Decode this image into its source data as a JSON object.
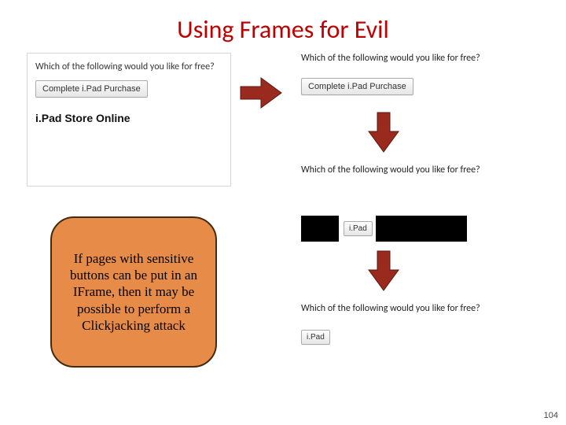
{
  "title": "Using Frames for Evil",
  "left_panel": {
    "question": "Which of the following would you like for free?",
    "button_label": "Complete i.Pad Purchase",
    "store_line": "i.Pad Store Online"
  },
  "right": {
    "q1": "Which of the following would you like for free?",
    "btn1": "Complete i.Pad Purchase",
    "q2": "Which of the following would you like for free?",
    "btn2": "i.Pad",
    "q3": "Which of the following would you like for free?",
    "btn3": "i.Pad"
  },
  "callout": "If pages with sensitive buttons can be put in an IFrame, then it may be possible to perform a Clickjacking attack",
  "page_number": "104"
}
